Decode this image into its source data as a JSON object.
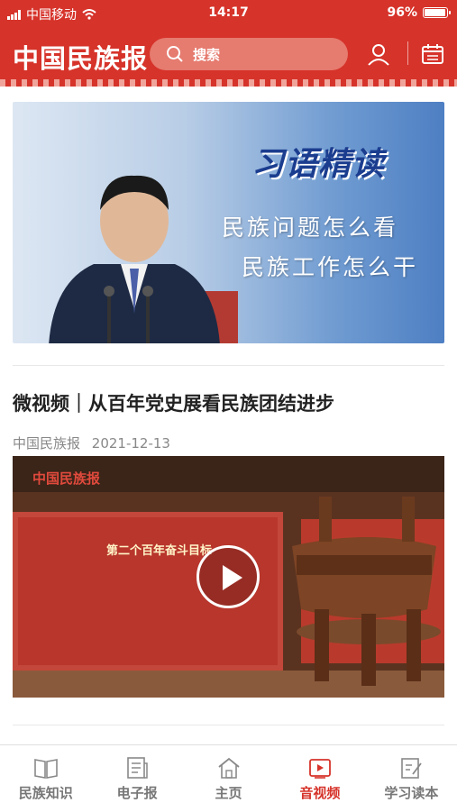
{
  "status_bar": {
    "carrier": "中国移动",
    "time": "14:17",
    "battery": "96%",
    "battery_level": 0.96
  },
  "header": {
    "logo": "中国民族报",
    "search_placeholder": "搜索"
  },
  "banner": {
    "title": "习语精读",
    "line1": "民族问题怎么看",
    "line2": "民族工作怎么干"
  },
  "article": {
    "title": "微视频｜从百年党史展看民族团结进步",
    "source": "中国民族报",
    "date": "2021-12-13",
    "video_watermark": "中国民族报",
    "video_panel_title": "第二个百年奋斗目标"
  },
  "tabs": [
    {
      "label": "民族知识",
      "icon": "book-icon"
    },
    {
      "label": "电子报",
      "icon": "newspaper-icon"
    },
    {
      "label": "主页",
      "icon": "home-icon"
    },
    {
      "label": "音视频",
      "icon": "video-icon",
      "active": true
    },
    {
      "label": "学习读本",
      "icon": "note-icon"
    }
  ],
  "colors": {
    "brand": "#d6332a",
    "active_tab": "#d6332a"
  }
}
